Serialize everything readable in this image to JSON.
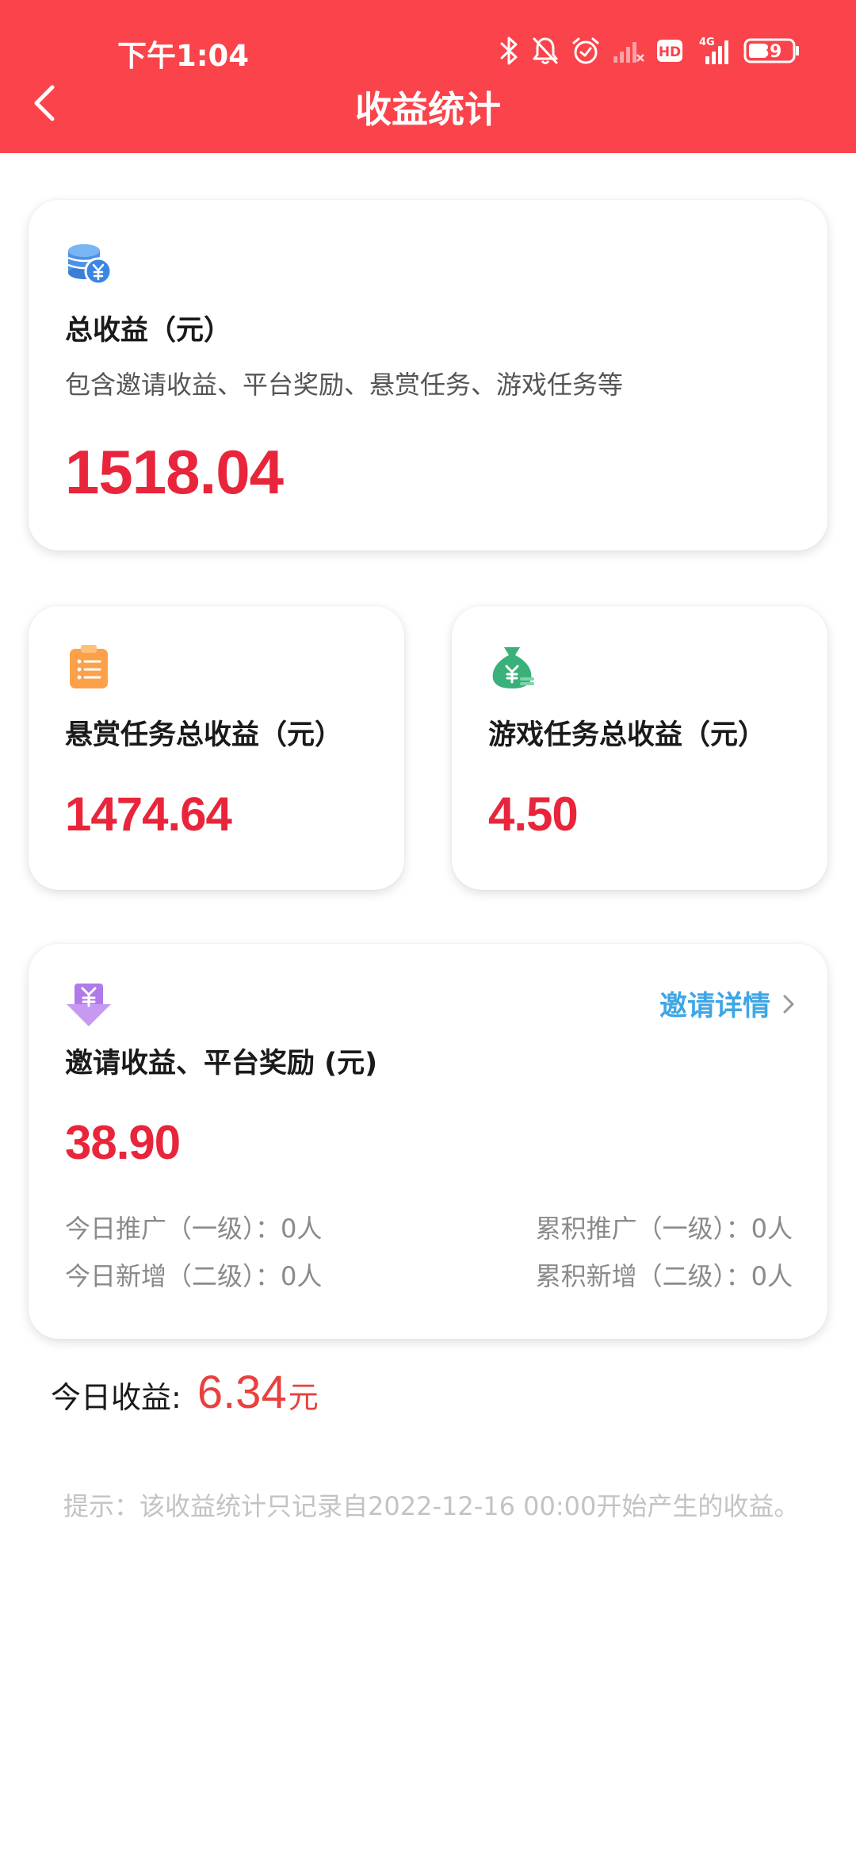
{
  "status_bar": {
    "time": "下午1:04",
    "network": "4G",
    "battery": "39",
    "hd_badge": "HD"
  },
  "nav": {
    "title": "收益统计"
  },
  "total_card": {
    "title": "总收益（元）",
    "subtitle": "包含邀请收益、平台奖励、悬赏任务、游戏任务等",
    "value": "1518.04",
    "icon": "coins-icon"
  },
  "reward_card": {
    "title": "悬赏任务总收益（元）",
    "value": "1474.64",
    "icon": "clipboard-list-icon"
  },
  "game_card": {
    "title": "游戏任务总收益（元）",
    "value": "4.50",
    "icon": "money-bag-icon"
  },
  "invite_card": {
    "title": "邀请收益、平台奖励 (元)",
    "value": "38.90",
    "icon": "yuan-down-arrow-icon",
    "link_label": "邀请详情",
    "stats": {
      "today_level1": "今日推广（一级）：0人",
      "total_level1": "累积推广（一级）：0人",
      "today_level2": "今日新增（二级）：0人",
      "total_level2": "累积新增（二级）：0人"
    }
  },
  "today": {
    "label": "今日收益:",
    "value": "6.34",
    "unit": "元"
  },
  "tip": "提示：该收益统计只记录自2022-12-16 00:00开始产生的收益。",
  "colors": {
    "header": "#fa434a",
    "value_red": "#e8253a",
    "link_blue": "#3fa6e6"
  }
}
